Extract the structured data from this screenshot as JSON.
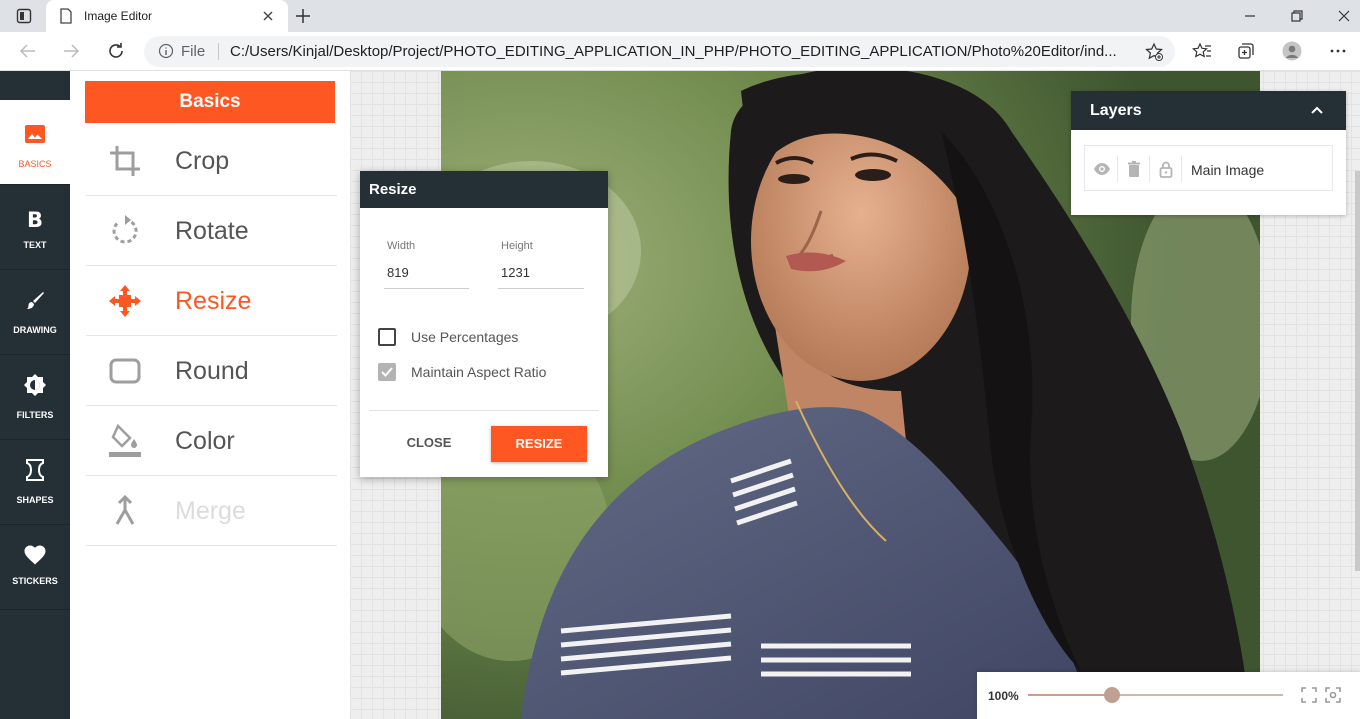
{
  "browser": {
    "tab_title": "Image Editor",
    "address_scheme": "File",
    "url": "C:/Users/Kinjal/Desktop/Project/PHOTO_EDITING_APPLICATION_IN_PHP/PHOTO_EDITING_APPLICATION/Photo%20Editor/ind..."
  },
  "leftnav": {
    "items": [
      {
        "label": "BASICS",
        "icon": "image-icon",
        "active": true
      },
      {
        "label": "TEXT",
        "icon": "bold-icon"
      },
      {
        "label": "DRAWING",
        "icon": "brush-icon"
      },
      {
        "label": "FILTERS",
        "icon": "brightness-icon"
      },
      {
        "label": "SHAPES",
        "icon": "hourglass-shape-icon"
      },
      {
        "label": "STICKERS",
        "icon": "heart-icon"
      }
    ]
  },
  "panel": {
    "header": "Basics",
    "tools": [
      {
        "label": "Crop",
        "icon": "crop-icon"
      },
      {
        "label": "Rotate",
        "icon": "rotate-icon"
      },
      {
        "label": "Resize",
        "icon": "resize-arrows-icon",
        "active": true
      },
      {
        "label": "Round",
        "icon": "rounded-rectangle-icon"
      },
      {
        "label": "Color",
        "icon": "paint-bucket-icon"
      },
      {
        "label": "Merge",
        "icon": "merge-icon",
        "disabled": true
      }
    ]
  },
  "resize_dialog": {
    "title": "Resize",
    "width_label": "Width",
    "width_value": "819",
    "height_label": "Height",
    "height_value": "1231",
    "use_percentages_label": "Use Percentages",
    "use_percentages_checked": false,
    "maintain_aspect_label": "Maintain Aspect Ratio",
    "maintain_aspect_checked": true,
    "close_label": "CLOSE",
    "resize_label": "RESIZE"
  },
  "layers": {
    "title": "Layers",
    "items": [
      {
        "name": "Main Image"
      }
    ]
  },
  "zoom": {
    "value_label": "100%",
    "level": 0.33
  },
  "colors": {
    "accent": "#ff5722",
    "dark": "#253036"
  }
}
